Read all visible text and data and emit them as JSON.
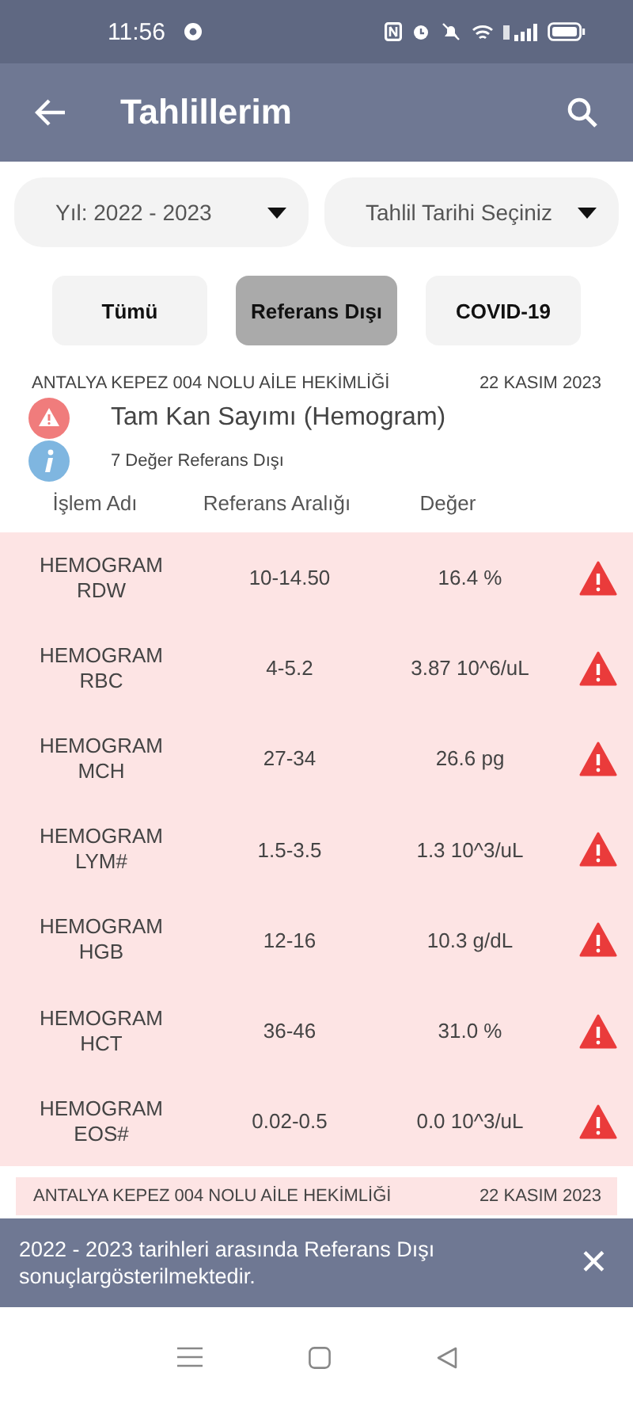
{
  "status_bar": {
    "time": "11:56"
  },
  "app_bar": {
    "title": "Tahlillerim"
  },
  "dropdowns": [
    {
      "value": "Yıl: 2022 - 2023"
    },
    {
      "value": "Tahlil Tarihi Seçiniz"
    }
  ],
  "filters": [
    {
      "label": "Tümü",
      "selected": false
    },
    {
      "label": "Referans Dışı",
      "selected": true
    },
    {
      "label": "COVID-19",
      "selected": false
    }
  ],
  "result": {
    "institution": "ANTALYA KEPEZ 004 NOLU AİLE HEKİMLİĞİ",
    "date": "22 KASIM 2023",
    "test_name": "Tam Kan Sayımı (Hemogram)",
    "summary": "7 Değer Referans Dışı",
    "columns": [
      "İşlem Adı",
      "Referans Aralığı",
      "Değer"
    ],
    "rows": [
      {
        "group": "HEMOGRAM",
        "name": "RDW",
        "range": "10-14.50",
        "value": "16.4 %",
        "out_of_range": true
      },
      {
        "group": "HEMOGRAM",
        "name": "RBC",
        "range": "4-5.2",
        "value": "3.87 10^6/uL",
        "out_of_range": true
      },
      {
        "group": "HEMOGRAM",
        "name": "MCH",
        "range": "27-34",
        "value": "26.6 pg",
        "out_of_range": true
      },
      {
        "group": "HEMOGRAM",
        "name": "LYM#",
        "range": "1.5-3.5",
        "value": "1.3 10^3/uL",
        "out_of_range": true
      },
      {
        "group": "HEMOGRAM",
        "name": "HGB",
        "range": "12-16",
        "value": "10.3 g/dL",
        "out_of_range": true
      },
      {
        "group": "HEMOGRAM",
        "name": "HCT",
        "range": "36-46",
        "value": "31.0 %",
        "out_of_range": true
      },
      {
        "group": "HEMOGRAM",
        "name": "EOS#",
        "range": "0.02-0.5",
        "value": "0.0 10^3/uL",
        "out_of_range": true
      }
    ]
  },
  "next_result": {
    "institution": "ANTALYA KEPEZ 004 NOLU AİLE HEKİMLİĞİ",
    "date": "22 KASIM 2023"
  },
  "snackbar": {
    "message": "2022 - 2023 tarihleri arasında Referans Dışı sonuçlargösterilmektedir.",
    "close": "✕"
  }
}
